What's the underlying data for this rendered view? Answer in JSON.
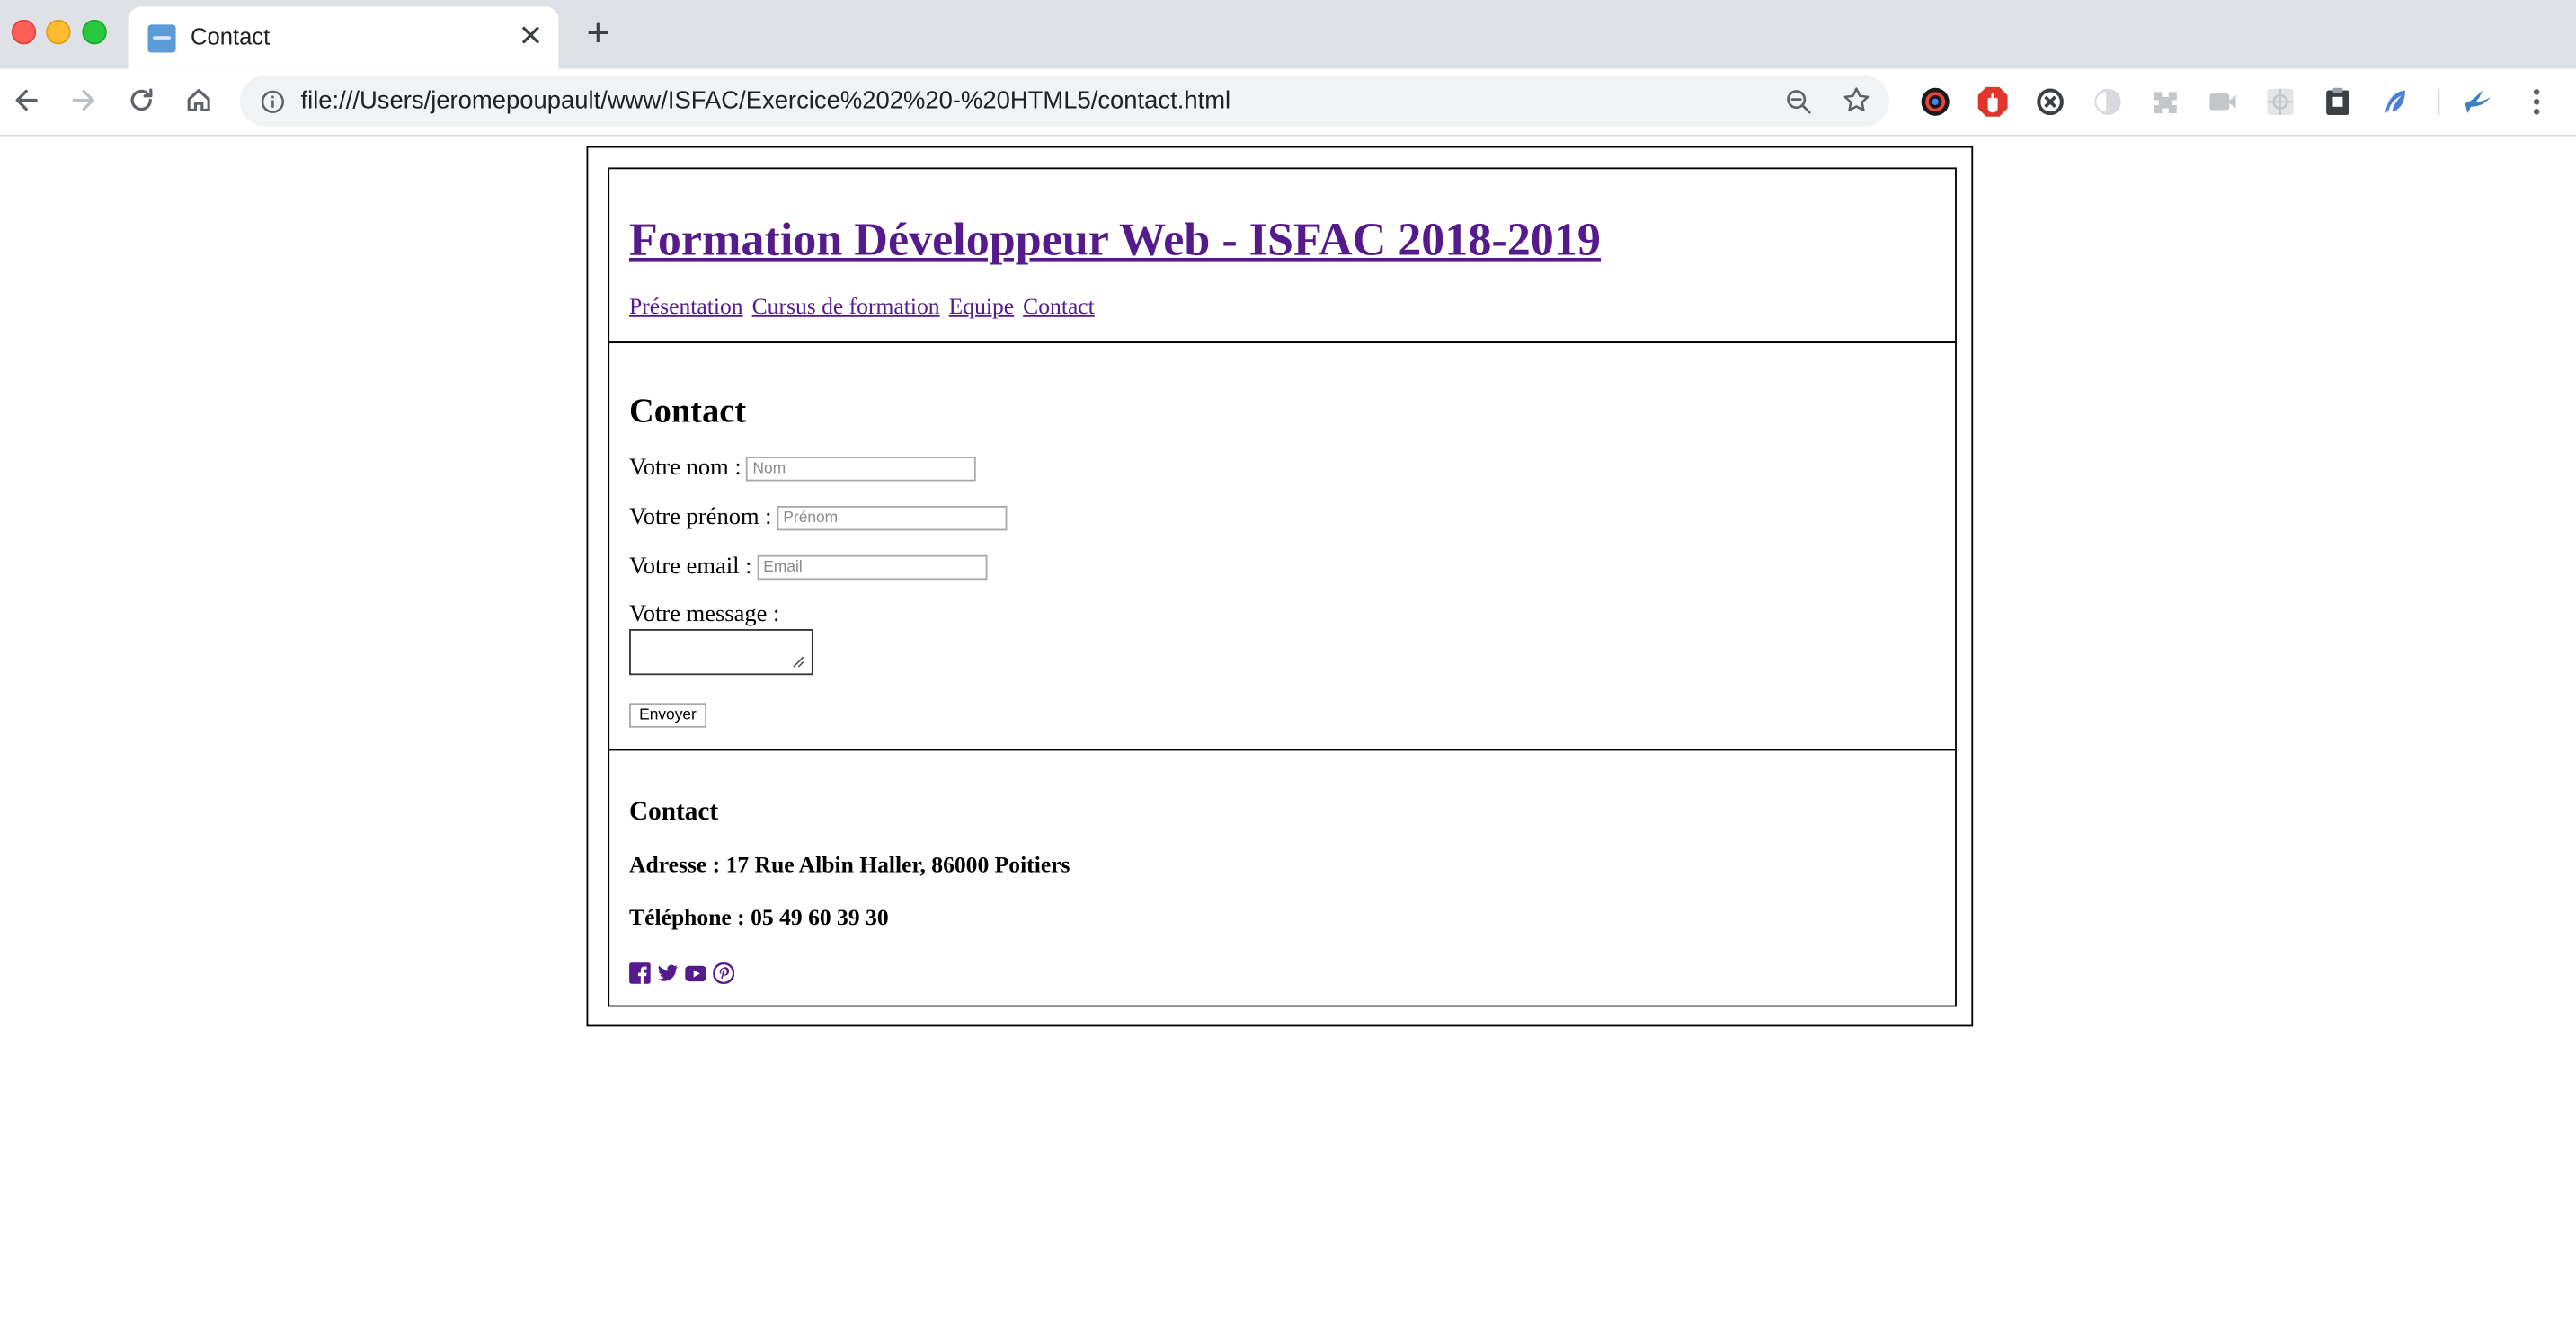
{
  "browser": {
    "tab_title": "Contact",
    "tab_close": "✕",
    "new_tab": "+",
    "url": "file:///Users/jeromepoupault/www/ISFAC/Exercice%202%20-%20HTML5/contact.html"
  },
  "page": {
    "site_title": "Formation Développeur Web - ISFAC 2018-2019",
    "nav": [
      "Présentation",
      "Cursus de formation",
      "Equipe",
      "Contact"
    ],
    "link_color": "#551a8b",
    "main_title": "Contact",
    "form": {
      "nom_label": "Votre nom :",
      "nom_placeholder": "Nom",
      "prenom_label": "Votre prénom :",
      "prenom_placeholder": "Prénom",
      "email_label": "Votre email :",
      "email_placeholder": "Email",
      "message_label": "Votre message :",
      "submit_label": "Envoyer"
    },
    "footer": {
      "title": "Contact",
      "address": "Adresse : 17 Rue Albin Haller, 86000 Poitiers",
      "phone": "Téléphone : 05 49 60 39 30",
      "social_icons": [
        "facebook-icon",
        "twitter-icon",
        "youtube-icon",
        "pinterest-icon"
      ]
    }
  }
}
